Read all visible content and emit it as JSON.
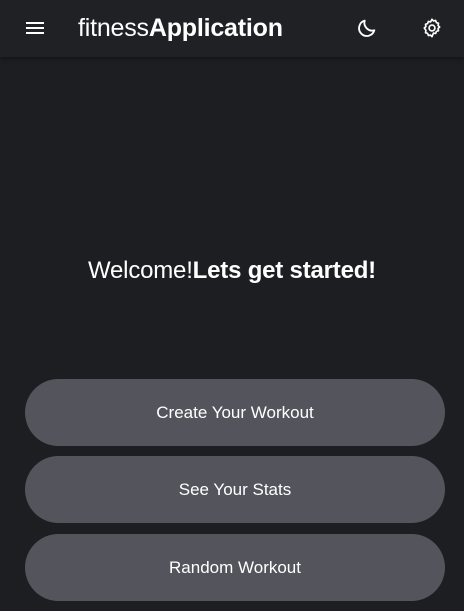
{
  "header": {
    "title_light": "fitness",
    "title_bold": "Application",
    "menu_icon": "hamburger-menu-icon",
    "theme_icon": "moon-icon",
    "settings_icon": "gear-icon"
  },
  "main": {
    "welcome_light": "Welcome!",
    "welcome_bold": "Lets get started!"
  },
  "actions": {
    "create_workout_label": "Create Your Workout",
    "see_stats_label": "See Your Stats",
    "random_workout_label": "Random Workout"
  },
  "colors": {
    "background": "#1c1e21",
    "header": "#1f2124",
    "button": "#54555c",
    "text": "#ffffff"
  }
}
